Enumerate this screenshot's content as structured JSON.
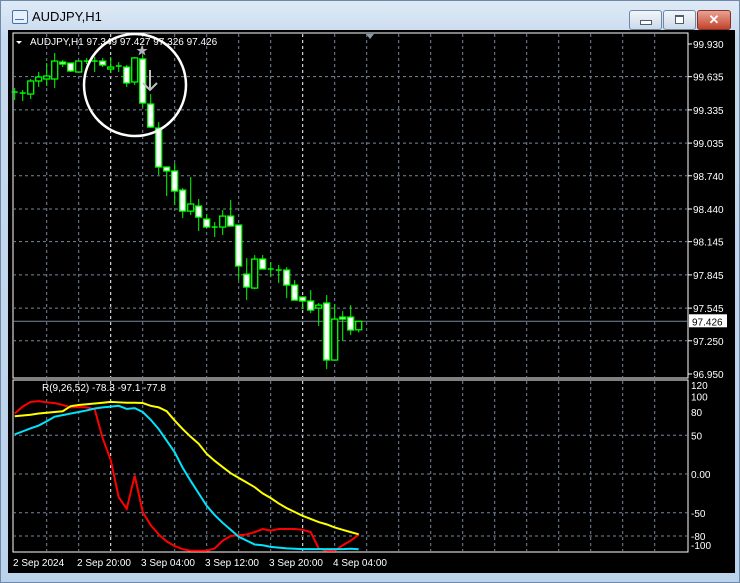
{
  "window": {
    "title": "AUDJPY,H1",
    "buttons": {
      "minimize": "minimize",
      "maximize": "maximize",
      "close": "✕"
    }
  },
  "chart": {
    "header": "AUDJPY,H1  97.349 97.427 97.326 97.426",
    "current_price_label": "97.426",
    "colors": {
      "background": "#000000",
      "candle": "#00ff00",
      "grid": "#778899",
      "price_line": "#778899",
      "indicator_fast": "#ff0000",
      "indicator_mid": "#00e5ff",
      "indicator_slow": "#ffff00",
      "annotation": "#ffffff"
    },
    "annotations": {
      "circle": "circle-highlight",
      "arrow": "down-arrow",
      "star": "star-marker"
    }
  },
  "chart_data": [
    {
      "type": "candlestick",
      "symbol": "AUDJPY",
      "timeframe": "H1",
      "ylim": [
        96.95,
        99.93
      ],
      "y_ticks": [
        "99.930",
        "99.635",
        "99.335",
        "99.035",
        "98.740",
        "98.440",
        "98.145",
        "97.845",
        "97.545",
        "97.250",
        "96.950"
      ],
      "x_tick_labels": [
        "2 Sep 2024",
        "2 Sep 20:00",
        "3 Sep 04:00",
        "3 Sep 12:00",
        "3 Sep 20:00",
        "4 Sep 04:00"
      ],
      "grid": true,
      "ohlc": [
        [
          99.496,
          99.533,
          99.424,
          99.487
        ],
        [
          99.487,
          99.514,
          99.415,
          99.478
        ],
        [
          99.478,
          99.614,
          99.433,
          99.596
        ],
        [
          99.596,
          99.677,
          99.542,
          99.632
        ],
        [
          99.614,
          99.758,
          99.551,
          99.641
        ],
        [
          99.614,
          99.849,
          99.533,
          99.776
        ],
        [
          99.767,
          99.785,
          99.722,
          99.749
        ],
        [
          99.758,
          99.758,
          99.677,
          99.686
        ],
        [
          99.677,
          99.776,
          99.677,
          99.776
        ],
        [
          99.776,
          99.804,
          99.749,
          99.776
        ],
        [
          99.776,
          99.813,
          99.677,
          99.776
        ],
        [
          99.776,
          99.804,
          99.722,
          99.74
        ],
        [
          99.704,
          99.813,
          99.668,
          99.722
        ],
        [
          99.731,
          99.767,
          99.677,
          99.731
        ],
        [
          99.722,
          99.74,
          99.542,
          99.578
        ],
        [
          99.587,
          99.813,
          99.56,
          99.804
        ],
        [
          99.795,
          99.831,
          99.361,
          99.397
        ],
        [
          99.388,
          99.478,
          99.171,
          99.18
        ],
        [
          99.171,
          99.225,
          98.747,
          98.819
        ],
        [
          98.819,
          98.819,
          98.557,
          98.783
        ],
        [
          98.783,
          98.855,
          98.476,
          98.602
        ],
        [
          98.611,
          98.629,
          98.358,
          98.421
        ],
        [
          98.421,
          98.729,
          98.385,
          98.485
        ],
        [
          98.467,
          98.53,
          98.241,
          98.367
        ],
        [
          98.349,
          98.394,
          98.268,
          98.277
        ],
        [
          98.277,
          98.322,
          98.187,
          98.277
        ],
        [
          98.277,
          98.431,
          98.205,
          98.376
        ],
        [
          98.376,
          98.521,
          98.286,
          98.286
        ],
        [
          98.295,
          98.295,
          97.798,
          97.925
        ],
        [
          97.852,
          97.997,
          97.617,
          97.735
        ],
        [
          97.726,
          98.024,
          97.717,
          97.988
        ],
        [
          97.988,
          98.024,
          97.898,
          97.898
        ],
        [
          97.898,
          97.961,
          97.825,
          97.898
        ],
        [
          97.889,
          97.934,
          97.771,
          97.889
        ],
        [
          97.889,
          97.916,
          97.636,
          97.753
        ],
        [
          97.753,
          97.798,
          97.617,
          97.617
        ],
        [
          97.645,
          97.645,
          97.536,
          97.609
        ],
        [
          97.609,
          97.708,
          97.5,
          97.527
        ],
        [
          97.545,
          97.591,
          97.383,
          97.572
        ],
        [
          97.591,
          97.663,
          96.994,
          97.076
        ],
        [
          97.076,
          97.581,
          97.076,
          97.446
        ],
        [
          97.464,
          97.518,
          97.247,
          97.446
        ],
        [
          97.464,
          97.572,
          97.301,
          97.347
        ],
        [
          97.349,
          97.427,
          97.326,
          97.426
        ]
      ],
      "last_price": 97.426
    },
    {
      "type": "line",
      "title": "R(9,26,52) -78.3 -97.1 -77.8",
      "ylim": [
        -100,
        120
      ],
      "y_ticks": [
        "120",
        "100",
        "80",
        "50",
        "0.00",
        "-50",
        "-80",
        "-100"
      ],
      "grid": true,
      "series": [
        {
          "color": "#ff0000",
          "values": [
            78,
            87,
            93,
            94,
            92.5,
            91.5,
            89,
            86,
            86.5,
            86,
            83.5,
            46,
            18,
            -30,
            -45,
            -2,
            -49,
            -66,
            -78,
            -87,
            -93,
            -97,
            -99,
            -99,
            -99,
            -96,
            -86,
            -80,
            -79,
            -78,
            -75,
            -71,
            -73,
            -71,
            -71,
            -71,
            -72,
            -75,
            -96,
            -99,
            -99,
            -92,
            -86,
            -78.3
          ]
        },
        {
          "color": "#00e5ff",
          "values": [
            51,
            55,
            59,
            62.5,
            68,
            74,
            76,
            78,
            80,
            82,
            84.5,
            86,
            87,
            88,
            84,
            85,
            80,
            70,
            58,
            43,
            28,
            8,
            -9,
            -25,
            -41,
            -53,
            -63,
            -72,
            -81,
            -86,
            -91,
            -92,
            -94,
            -95,
            -96,
            -96.5,
            -97,
            -97,
            -97,
            -97,
            -97,
            -97,
            -96.5,
            -97.1
          ]
        },
        {
          "color": "#ffff00",
          "values": [
            74.5,
            75.5,
            76.5,
            78,
            79,
            80,
            81,
            87.5,
            89,
            90,
            91,
            92,
            93,
            92.5,
            92,
            92,
            91.6,
            88,
            86,
            81,
            69,
            58,
            48,
            39,
            26,
            17,
            9,
            1,
            -5,
            -11,
            -17,
            -25,
            -31,
            -38,
            -44,
            -49,
            -54,
            -58,
            -62,
            -65,
            -69,
            -72,
            -75,
            -77.8
          ]
        }
      ]
    }
  ]
}
